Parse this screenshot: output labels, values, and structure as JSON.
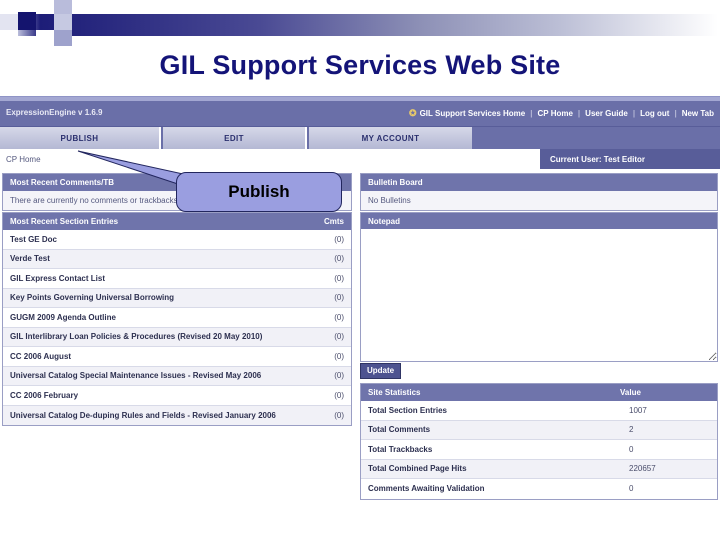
{
  "slide": {
    "title": "GIL Support Services Web Site"
  },
  "callout": {
    "label": "Publish"
  },
  "app": {
    "version_label": "ExpressionEngine v 1.6.9",
    "topnav": {
      "home_icon": "home-icon",
      "links": [
        "GIL Support Services Home",
        "CP Home",
        "User Guide",
        "Log out",
        "New Tab"
      ],
      "separator": "|"
    },
    "tabs": [
      {
        "label": "PUBLISH"
      },
      {
        "label": "EDIT"
      },
      {
        "label": "MY ACCOUNT"
      }
    ],
    "breadcrumb": "CP Home",
    "current_user": "Current User:  Test Editor"
  },
  "left": {
    "comments_panel": {
      "title": "Most Recent Comments/TB",
      "empty_message": "There are currently no comments or trackbacks"
    },
    "entries_panel": {
      "title": "Most Recent Section Entries",
      "count_header": "Cmts",
      "rows": [
        {
          "title": "Test GE Doc",
          "cmts": "(0)"
        },
        {
          "title": "Verde Test",
          "cmts": "(0)"
        },
        {
          "title": "GIL Express Contact List",
          "cmts": "(0)"
        },
        {
          "title": "Key Points Governing Universal Borrowing",
          "cmts": "(0)"
        },
        {
          "title": "GUGM 2009 Agenda Outline",
          "cmts": "(0)"
        },
        {
          "title": "GIL Interlibrary Loan Policies & Procedures (Revised 20 May 2010)",
          "cmts": "(0)"
        },
        {
          "title": "CC 2006 August",
          "cmts": "(0)"
        },
        {
          "title": "Universal Catalog Special Maintenance Issues - Revised May 2006",
          "cmts": "(0)"
        },
        {
          "title": "CC 2006 February",
          "cmts": "(0)"
        },
        {
          "title": "Universal Catalog De-duping Rules and Fields - Revised January 2006",
          "cmts": "(0)"
        }
      ]
    }
  },
  "right": {
    "bulletin_panel": {
      "title": "Bulletin Board",
      "empty_message": "No Bulletins"
    },
    "notepad_panel": {
      "title": "Notepad",
      "value": "",
      "update_label": "Update"
    },
    "stats_panel": {
      "title": "Site Statistics",
      "value_header": "Value",
      "rows": [
        {
          "label": "Total Section Entries",
          "value": "1007"
        },
        {
          "label": "Total Comments",
          "value": "2"
        },
        {
          "label": "Total Trackbacks",
          "value": "0"
        },
        {
          "label": "Total Combined Page Hits",
          "value": "220657"
        },
        {
          "label": "Comments Awaiting Validation",
          "value": "0"
        }
      ]
    }
  },
  "colors": {
    "title_navy": "#141478",
    "chrome_purple": "#6a6fa8",
    "panel_head": "#6f74ab",
    "callout_fill": "#9a9ee0",
    "accent_gold": "#e8c96a"
  }
}
